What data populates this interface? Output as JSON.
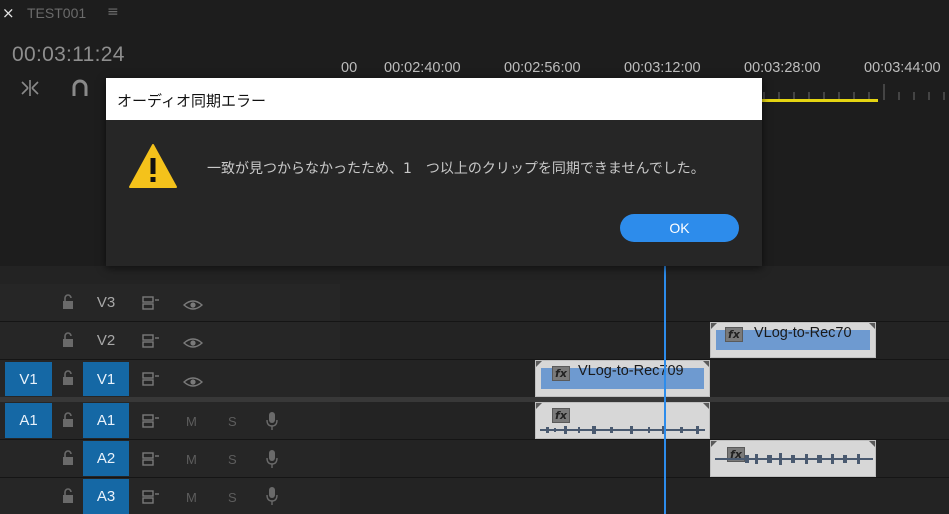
{
  "tab": {
    "close_symbol": "×",
    "sequence_name": "TEST001",
    "menu_symbol": "≡"
  },
  "timecode": "00:03:11:24",
  "ruler": {
    "labels": [
      "00",
      "00:02:40:00",
      "00:02:56:00",
      "00:03:12:00",
      "00:03:28:00",
      "00:03:44:00"
    ]
  },
  "colors": {
    "accent_blue": "#2d8ceb",
    "track_target_blue": "#1568a5",
    "work_area_yellow": "#e4d412",
    "clip_video_blue": "#6e9ad0"
  },
  "dialog": {
    "title": "オーディオ同期エラー",
    "message": "一致が見つからなかったため、1　つ以上のクリップを同期できませんでした。",
    "ok_label": "OK",
    "icon": "warning-icon"
  },
  "tracks": {
    "video": [
      {
        "source": "",
        "name": "V3"
      },
      {
        "source": "",
        "name": "V2"
      },
      {
        "source": "V1",
        "name": "V1"
      }
    ],
    "audio": [
      {
        "source": "A1",
        "name": "A1",
        "mute": "M",
        "solo": "S"
      },
      {
        "source": "",
        "name": "A2",
        "mute": "M",
        "solo": "S"
      },
      {
        "source": "",
        "name": "A3",
        "mute": "M",
        "solo": "S"
      }
    ]
  },
  "clips": {
    "v2_clip_name": "VLog-to-Rec70",
    "v1_clip_name": "VLog-to-Rec709",
    "fx_badge": "fx"
  }
}
